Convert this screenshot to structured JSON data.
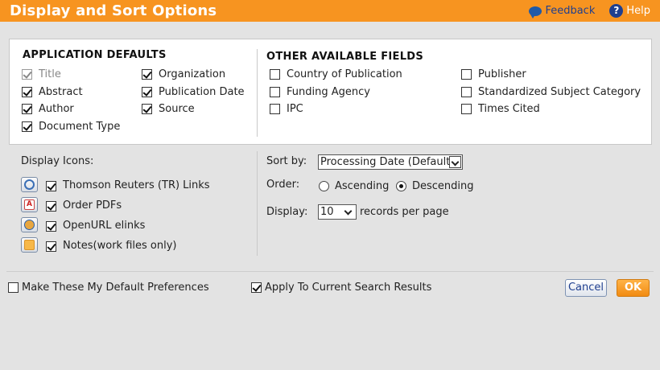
{
  "header": {
    "title": "Display and Sort Options",
    "feedback_label": "Feedback",
    "help_label": "Help"
  },
  "application_defaults": {
    "heading": "APPLICATION DEFAULTS",
    "fields": [
      {
        "label": "Title",
        "checked": true,
        "disabled": true
      },
      {
        "label": "Abstract",
        "checked": true,
        "disabled": false
      },
      {
        "label": "Author",
        "checked": true,
        "disabled": false
      },
      {
        "label": "Document Type",
        "checked": true,
        "disabled": false
      },
      {
        "label": "Organization",
        "checked": true,
        "disabled": false
      },
      {
        "label": "Publication Date",
        "checked": true,
        "disabled": false
      },
      {
        "label": "Source",
        "checked": true,
        "disabled": false
      }
    ]
  },
  "other_fields": {
    "heading": "OTHER AVAILABLE FIELDS",
    "fields": [
      {
        "label": "Country of Publication",
        "checked": false
      },
      {
        "label": "Funding Agency",
        "checked": false
      },
      {
        "label": "IPC",
        "checked": false
      },
      {
        "label": "Publisher",
        "checked": false
      },
      {
        "label": "Standardized Subject Category",
        "checked": false
      },
      {
        "label": "Times Cited",
        "checked": false
      }
    ]
  },
  "display_icons": {
    "heading": "Display Icons:",
    "items": [
      {
        "label": "Thomson Reuters (TR) Links",
        "checked": true,
        "icon": "tr-links-icon"
      },
      {
        "label": "Order PDFs",
        "checked": true,
        "icon": "pdf-icon"
      },
      {
        "label": "OpenURL elinks",
        "checked": true,
        "icon": "openurl-icon"
      },
      {
        "label": "Notes(work files only)",
        "checked": true,
        "icon": "notes-icon"
      }
    ]
  },
  "sort": {
    "sort_by_label": "Sort by:",
    "sort_by_value": "Processing Date (Default)",
    "order_label": "Order:",
    "ascending_label": "Ascending",
    "descending_label": "Descending",
    "selected_order": "Descending",
    "display_label": "Display:",
    "display_value": "10",
    "records_per_page_label": "records per page"
  },
  "footer": {
    "make_default_label": "Make These My Default Preferences",
    "make_default_checked": false,
    "apply_current_label": "Apply To Current Search Results",
    "apply_current_checked": true,
    "cancel_label": "Cancel",
    "ok_label": "OK"
  },
  "colors": {
    "header_bg": "#f79420",
    "link_blue": "#1f3f8f",
    "panel_bg": "#e3e3e3"
  }
}
